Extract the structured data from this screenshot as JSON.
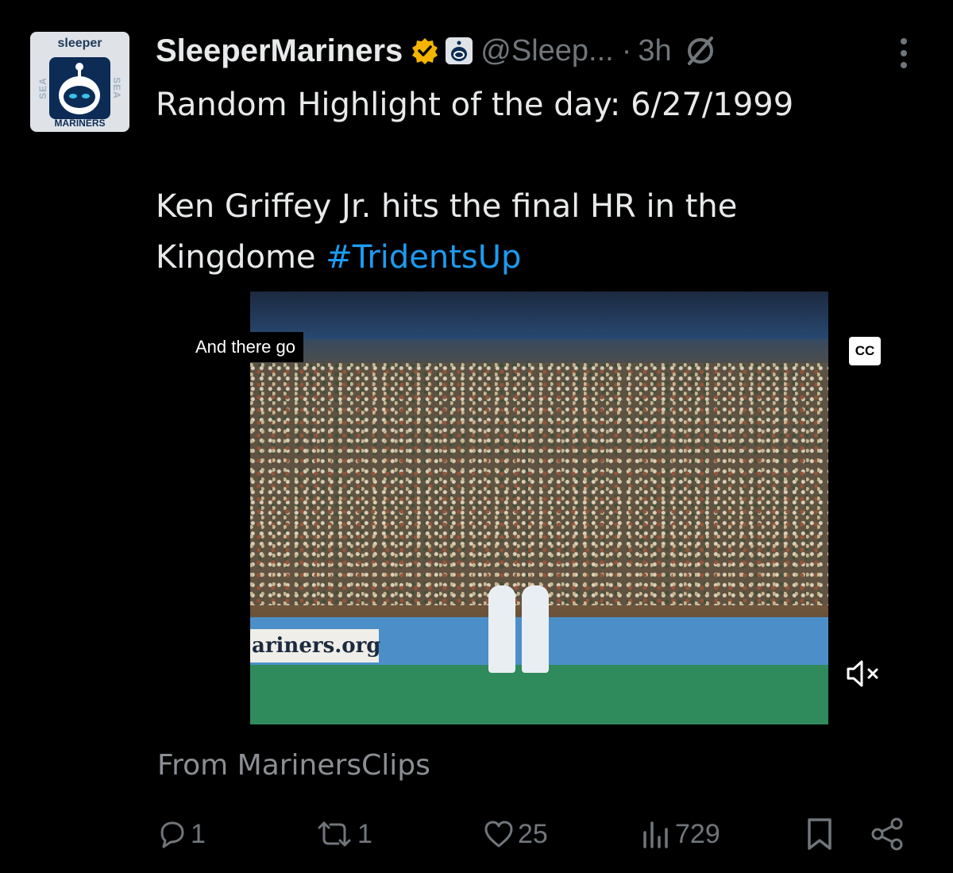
{
  "avatar": {
    "brand": "sleeper",
    "side_left": "SEA",
    "side_right": "SEA",
    "team": "MARINERS"
  },
  "header": {
    "display_name": "SleeperMariners",
    "handle": "@Sleep...",
    "separator": "·",
    "time": "3h"
  },
  "tweet": {
    "line1": "Random Highlight of the day: 6/27/1999",
    "line2_text": "Ken Griffey Jr. hits the final HR in the Kingdome ",
    "hashtag": "#TridentsUp"
  },
  "video": {
    "subtitle": "And there go",
    "cc_label": "CC",
    "adboard_text": "ariners.org"
  },
  "source": {
    "from_text": "From MarinersClips"
  },
  "actions": {
    "replies": "1",
    "reposts": "1",
    "likes": "25",
    "views": "729"
  },
  "colors": {
    "background": "#000000",
    "text": "#e7e9ea",
    "muted": "#71767b",
    "link": "#1d9bf0",
    "verified_gold": "#f5b400"
  }
}
